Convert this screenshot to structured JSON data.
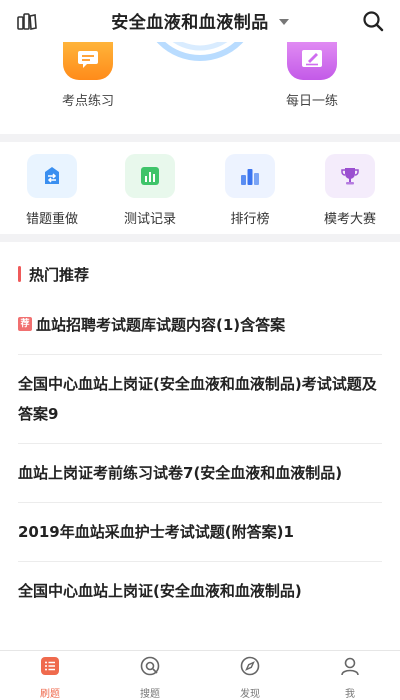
{
  "header": {
    "title": "安全血液和血液制品",
    "left_icon": "books-icon",
    "right_icon": "search-icon"
  },
  "quick_actions": [
    {
      "label": "考点练习",
      "icon": "message-icon",
      "color": "#ff9a26"
    },
    {
      "label": "每日一练",
      "icon": "edit-icon",
      "color": "#cf6cf0"
    }
  ],
  "features": [
    {
      "label": "错题重做",
      "icon": "redo-icon"
    },
    {
      "label": "测试记录",
      "icon": "record-chart-icon"
    },
    {
      "label": "排行榜",
      "icon": "ranking-bars-icon"
    },
    {
      "label": "模考大赛",
      "icon": "trophy-icon"
    }
  ],
  "hot": {
    "title": "热门推荐",
    "items": [
      {
        "tag": "荐",
        "title": "血站招聘考试题库试题内容(1)含答案"
      },
      {
        "tag": "",
        "title": "全国中心血站上岗证(安全血液和血液制品)考试试题及答案9"
      },
      {
        "tag": "",
        "title": "血站上岗证考前练习试卷7(安全血液和血液制品)"
      },
      {
        "tag": "",
        "title": "2019年血站采血护士考试试题(附答案)1"
      },
      {
        "tag": "",
        "title": "全国中心血站上岗证(安全血液和血液制品)"
      }
    ]
  },
  "tabs": [
    {
      "label": "刷题",
      "icon": "list-icon",
      "active": true
    },
    {
      "label": "搜题",
      "icon": "search-question-icon",
      "active": false
    },
    {
      "label": "发现",
      "icon": "compass-icon",
      "active": false
    },
    {
      "label": "我",
      "icon": "user-icon",
      "active": false
    }
  ],
  "colors": {
    "accent": "#ef6a4d",
    "section_bar": "#ef5a5a",
    "divider": "#f2f2f4"
  }
}
